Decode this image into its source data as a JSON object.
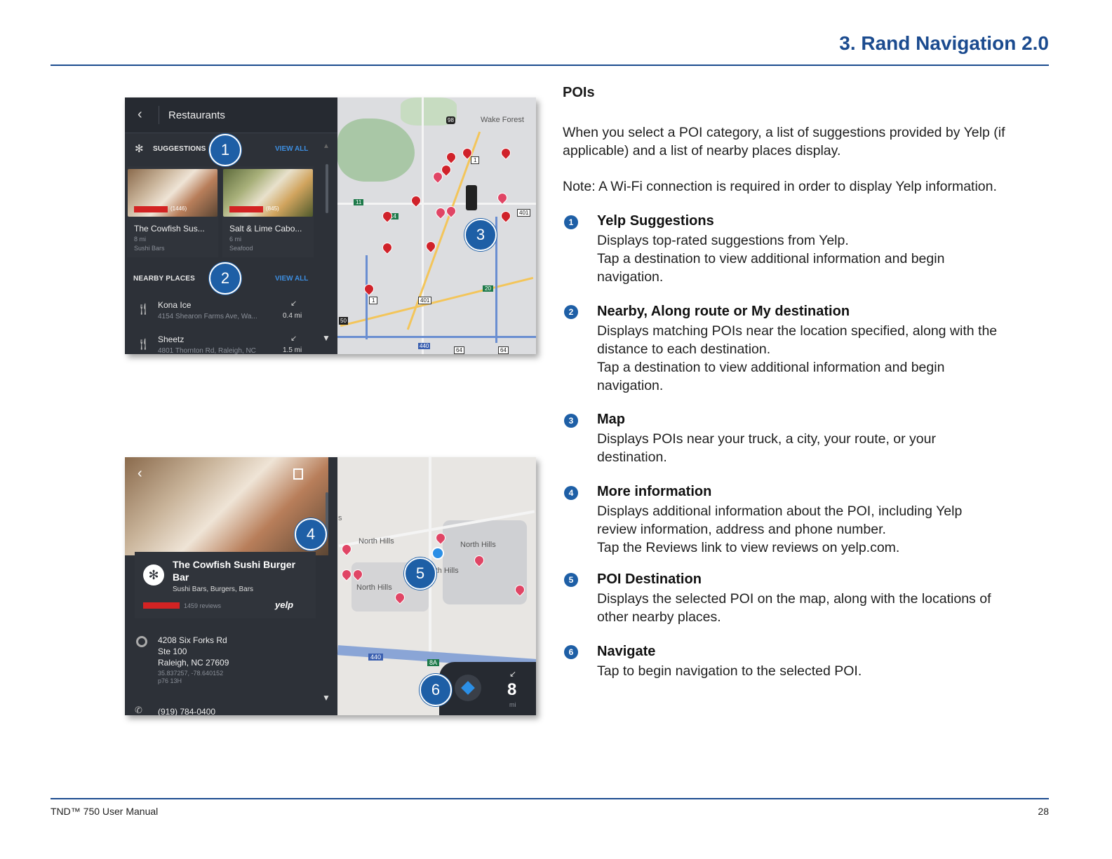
{
  "header": {
    "section_title": "3. Rand Navigation 2.0"
  },
  "footer": {
    "manual": "TND™ 750 User Manual",
    "page": "28"
  },
  "screen1": {
    "header_title": "Restaurants",
    "suggestions_label": "SUGGESTIONS",
    "view_all_1": "VIEW ALL",
    "nearby_label": "NEARBY PLACES",
    "view_all_2": "VIEW ALL",
    "cards": [
      {
        "reviews": "(1446)",
        "name": "The Cowfish Sus...",
        "distance": "8 mi",
        "category": "Sushi Bars"
      },
      {
        "reviews": "(845)",
        "name": "Salt & Lime Cabo...",
        "distance": "6 mi",
        "category": "Seafood"
      }
    ],
    "nearby": [
      {
        "name": "Kona Ice",
        "address": "4154 Shearon Farms Ave, Wa...",
        "distance": "0.4 mi"
      },
      {
        "name": "Sheetz",
        "address": "4801 Thornton Rd, Raleigh, NC",
        "distance": "1.5 mi"
      }
    ],
    "map_labels": {
      "town": "Wake Forest",
      "r98": "98",
      "r1a": "1",
      "r11": "11",
      "r14": "14",
      "r401a": "401",
      "r401b": "401",
      "r1b": "1",
      "r20": "20",
      "r50": "50",
      "r440": "440",
      "r64a": "64",
      "r64b": "64"
    }
  },
  "screen2": {
    "poi_name_line1": "The Cowfish Sushi Burger",
    "poi_name_line2": "Bar",
    "poi_categories": "Sushi Bars, Burgers, Bars",
    "reviews": "1459 reviews",
    "yelp": "yelp",
    "address_1": "4208 Six Forks Rd",
    "address_2": "Ste 100",
    "address_3": "Raleigh, NC 27609",
    "coords": "35.837257, -78.640152",
    "plus_code": "p76 13H",
    "phone": "(919) 784-0400",
    "map_labels": {
      "nh1": "North Hills",
      "nh2": "North Hills",
      "nh3": "rth Hills",
      "nh4": "North Hills",
      "hwy440": "440",
      "exit": "8A",
      "s": "s"
    },
    "nav_distance": "8",
    "nav_unit": "mi"
  },
  "callouts": [
    "1",
    "2",
    "3",
    "4",
    "5",
    "6"
  ],
  "content": {
    "heading": "POIs",
    "intro_1": "When you select a POI category, a list of suggestions provided by Yelp (if",
    "intro_2": "applicable) and a list of nearby places display.",
    "note": "Note: A Wi-Fi connection is required in order to display Yelp information.",
    "items": [
      {
        "num": "1",
        "title": "Yelp Suggestions",
        "lines": [
          "Displays top-rated suggestions from Yelp.",
          "Tap a destination to view additional information and begin",
          "navigation."
        ]
      },
      {
        "num": "2",
        "title": "Nearby, Along route or My destination",
        "lines": [
          "Displays matching POIs near the location specified, along with the",
          "distance to each destination.",
          "Tap a destination to view additional information and begin",
          "navigation."
        ]
      },
      {
        "num": "3",
        "title": "Map",
        "lines": [
          "Displays POIs near your truck, a city, your route, or your",
          "destination."
        ]
      },
      {
        "num": "4",
        "title": "More information",
        "lines": [
          "Displays additional information about the POI, including Yelp",
          "review information, address and phone number.",
          "Tap the Reviews link to view reviews on yelp.com."
        ]
      },
      {
        "num": "5",
        "title": "POI Destination",
        "lines": [
          "Displays the selected POI on the map, along with the locations of",
          "other nearby places."
        ]
      },
      {
        "num": "6",
        "title": "Navigate",
        "lines": [
          "Tap to begin navigation to the selected POI."
        ]
      }
    ]
  }
}
